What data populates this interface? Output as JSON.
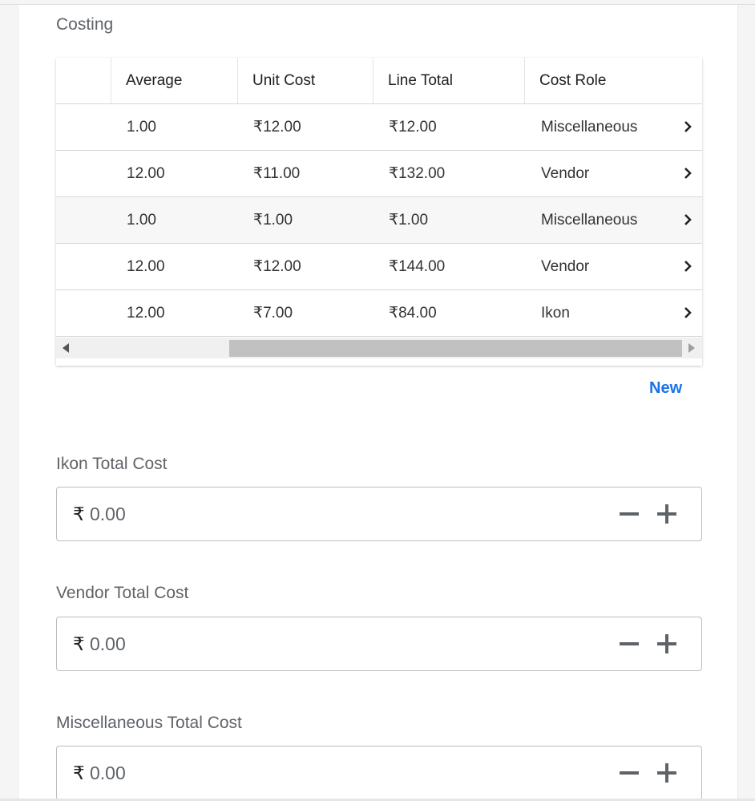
{
  "section": {
    "title": "Costing"
  },
  "table": {
    "columns": [
      "Average",
      "Unit Cost",
      "Line Total",
      "Cost Role"
    ],
    "rows": [
      {
        "average": "1.00",
        "unit_cost": "₹12.00",
        "line_total": "₹12.00",
        "cost_role": "Miscellaneous"
      },
      {
        "average": "12.00",
        "unit_cost": "₹11.00",
        "line_total": "₹132.00",
        "cost_role": "Vendor"
      },
      {
        "average": "1.00",
        "unit_cost": "₹1.00",
        "line_total": "₹1.00",
        "cost_role": "Miscellaneous"
      },
      {
        "average": "12.00",
        "unit_cost": "₹12.00",
        "line_total": "₹144.00",
        "cost_role": "Vendor"
      },
      {
        "average": "12.00",
        "unit_cost": "₹7.00",
        "line_total": "₹84.00",
        "cost_role": "Ikon"
      }
    ]
  },
  "new_label": "New",
  "fields": [
    {
      "label": "Ikon Total Cost",
      "prefix": "₹",
      "value": "0.00"
    },
    {
      "label": "Vendor Total Cost",
      "prefix": "₹",
      "value": "0.00"
    },
    {
      "label": "Miscellaneous Total Cost",
      "prefix": "₹",
      "value": "0.00"
    }
  ],
  "colors": {
    "accent": "#1a73e8",
    "text": "#202124",
    "muted": "#5f6368",
    "border": "#bdbdbd"
  },
  "icons": {
    "row_action": "chevron-right-icon",
    "decrement": "minus-icon",
    "increment": "plus-icon"
  }
}
